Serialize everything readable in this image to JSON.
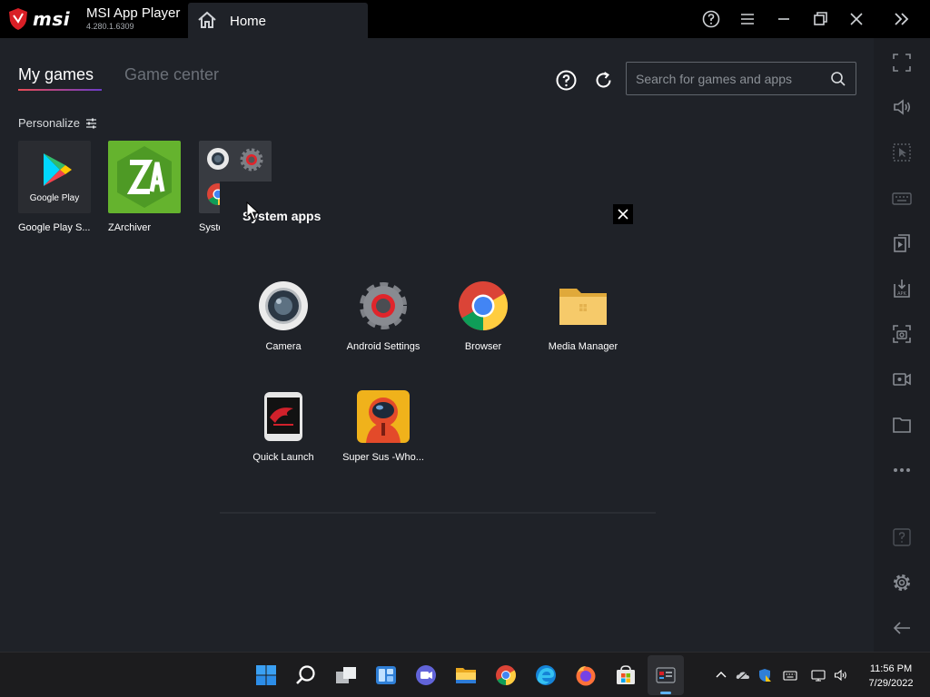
{
  "titlebar": {
    "brand": "msi",
    "app_name": "MSI App Player",
    "version": "4.280.1.6309",
    "home_tab": "Home",
    "icons": [
      "help-icon",
      "menu-icon",
      "minimize-icon",
      "restore-icon",
      "close-icon",
      "expand-sidebar-icon"
    ]
  },
  "main": {
    "tabs": [
      {
        "label": "My games",
        "active": true
      },
      {
        "label": "Game center",
        "active": false
      }
    ],
    "search": {
      "placeholder": "Search for games and apps",
      "value": ""
    },
    "personalize_label": "Personalize",
    "apps": [
      {
        "name": "Google Play S...",
        "thumb_text": "Google Play"
      },
      {
        "name": "ZArchiver"
      },
      {
        "name": "Syste"
      }
    ]
  },
  "popup": {
    "title": "System apps",
    "apps": [
      {
        "name": "Camera",
        "icon": "camera-icon"
      },
      {
        "name": "Android Settings",
        "icon": "settings-gear-icon"
      },
      {
        "name": "Browser",
        "icon": "chrome-icon"
      },
      {
        "name": "Media Manager",
        "icon": "folder-icon"
      },
      {
        "name": "Quick Launch",
        "icon": "quick-launch-icon"
      },
      {
        "name": "Super Sus -Who...",
        "icon": "super-sus-icon"
      }
    ]
  },
  "sidebar": {
    "icons": [
      "fullscreen-icon",
      "volume-icon",
      "pointer-select-icon",
      "keyboard-icon",
      "multi-instance-icon",
      "install-apk-icon",
      "screenshot-icon",
      "record-icon",
      "folder-icon",
      "more-icon",
      "help-icon",
      "settings-icon",
      "back-arrow-icon"
    ]
  },
  "taskbar": {
    "clock_time": "11:56 PM",
    "clock_date": "7/29/2022"
  },
  "colors": {
    "titlebar_bg": "#000000",
    "main_bg": "#1f2228",
    "accent_gradient_start": "#e84c56",
    "accent_gradient_end": "#6b3cc7",
    "msi_red": "#d91f26",
    "taskbar_active": "#5fb2f2"
  }
}
